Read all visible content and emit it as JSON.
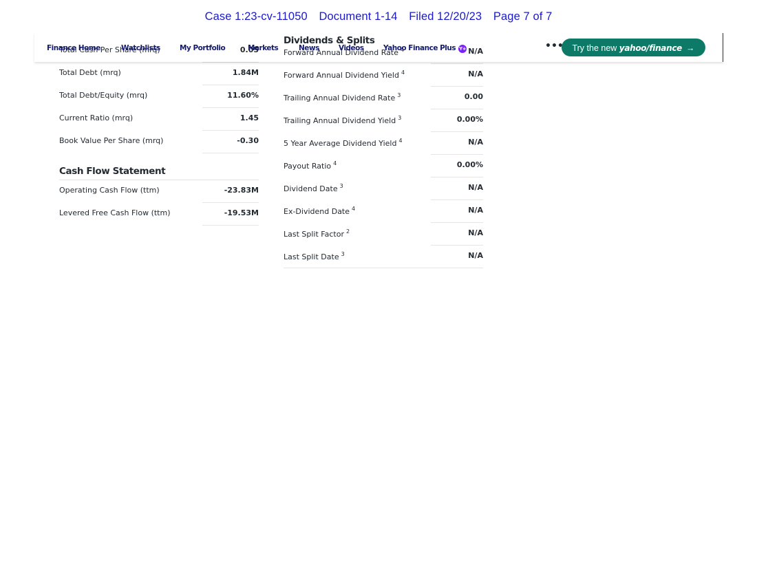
{
  "court_header": {
    "case": "Case 1:23-cv-11050",
    "document": "Document 1-14",
    "filed": "Filed 12/20/23",
    "page": "Page 7 of 7"
  },
  "nav": {
    "finance_home": "Finance Home",
    "watchlists": "Watchlists",
    "my_portfolio": "My Portfolio",
    "markets": "Markets",
    "news": "News",
    "videos": "Videos",
    "yahoo_finance_plus": "Yahoo Finance Plus",
    "yplus_badge": "Y+",
    "more": "•••",
    "try_prefix": "Try the new",
    "try_brand": "yahoo/finance",
    "try_arrow": "→"
  },
  "balance_sheet": {
    "rows": [
      {
        "label": "Total Cash Per Share (mrq)",
        "value": "0.05"
      },
      {
        "label": "Total Debt (mrq)",
        "value": "1.84M"
      },
      {
        "label": "Total Debt/Equity (mrq)",
        "value": "11.60%"
      },
      {
        "label": "Current Ratio (mrq)",
        "value": "1.45"
      },
      {
        "label": "Book Value Per Share (mrq)",
        "value": "-0.30"
      }
    ]
  },
  "cash_flow": {
    "title": "Cash Flow Statement",
    "rows": [
      {
        "label": "Operating Cash Flow (ttm)",
        "value": "-23.83M"
      },
      {
        "label": "Levered Free Cash Flow (ttm)",
        "value": "-19.53M"
      }
    ]
  },
  "dividends": {
    "title": "Dividends & Splits",
    "rows": [
      {
        "label": "Forward Annual Dividend Rate",
        "note": "4",
        "value": "N/A"
      },
      {
        "label": "Forward Annual Dividend Yield",
        "note": "4",
        "value": "N/A"
      },
      {
        "label": "Trailing Annual Dividend Rate",
        "note": "3",
        "value": "0.00"
      },
      {
        "label": "Trailing Annual Dividend Yield",
        "note": "3",
        "value": "0.00%"
      },
      {
        "label": "5 Year Average Dividend Yield",
        "note": "4",
        "value": "N/A"
      },
      {
        "label": "Payout Ratio",
        "note": "4",
        "value": "0.00%"
      },
      {
        "label": "Dividend Date",
        "note": "3",
        "value": "N/A"
      },
      {
        "label": "Ex-Dividend Date",
        "note": "4",
        "value": "N/A"
      },
      {
        "label": "Last Split Factor",
        "note": "2",
        "value": "N/A"
      },
      {
        "label": "Last Split Date",
        "note": "3",
        "value": "N/A"
      }
    ]
  }
}
